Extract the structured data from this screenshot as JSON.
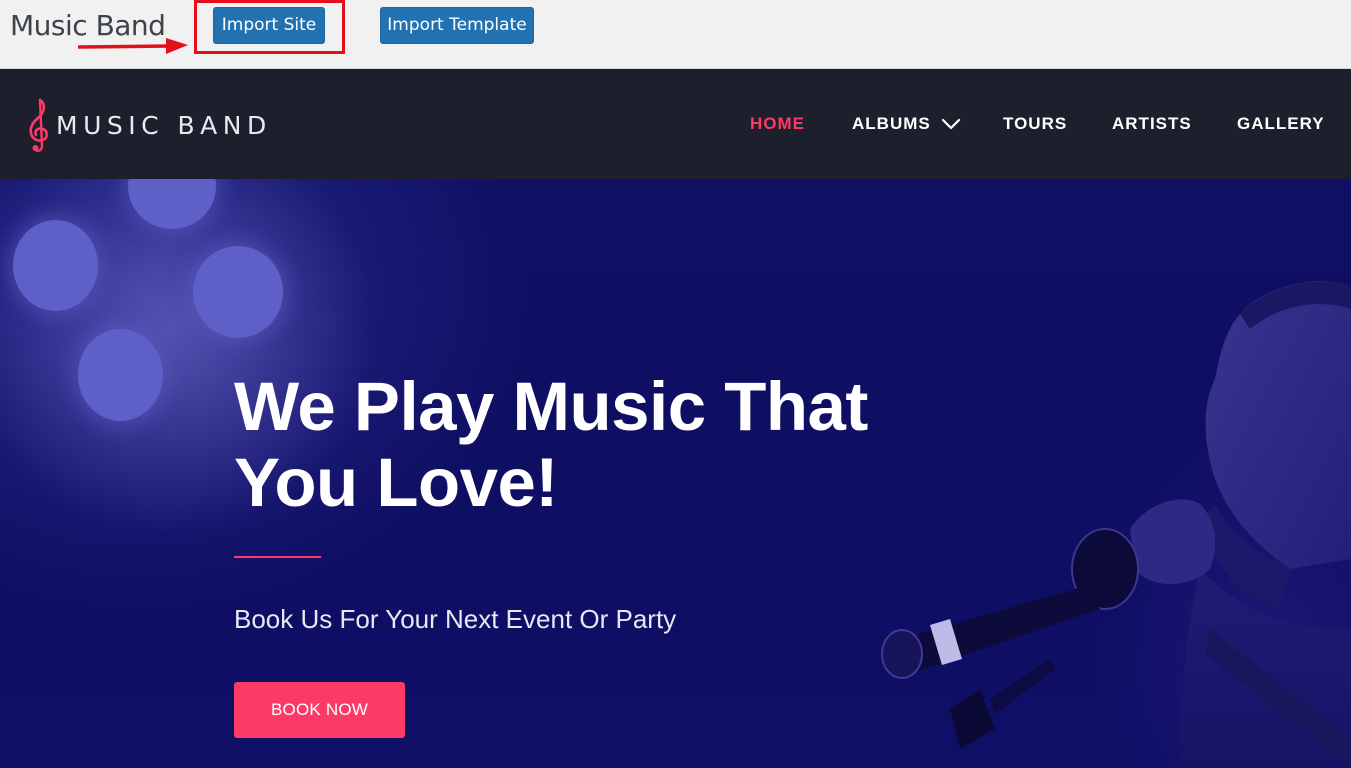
{
  "admin": {
    "site_title": "Music Band",
    "import_site_label": "Import Site",
    "import_template_label": "Import Template"
  },
  "header": {
    "logo_text": "MUSIC BAND",
    "nav": [
      {
        "label": "HOME",
        "active": true
      },
      {
        "label": "ALBUMS",
        "has_dropdown": true
      },
      {
        "label": "TOURS"
      },
      {
        "label": "ARTISTS"
      },
      {
        "label": "GALLERY"
      }
    ]
  },
  "hero": {
    "title": "We Play Music That You Love!",
    "subtitle": "Book Us For Your Next Event Or Party",
    "cta_label": "BOOK NOW"
  },
  "colors": {
    "accent": "#fb3b66",
    "admin_button": "#2271b1",
    "header_bg": "#1d1f2c",
    "hero_bg": "#0e0e62",
    "annotation": "#e3101c"
  },
  "icons": {
    "logo": "treble-clef-icon",
    "dropdown": "chevron-down-icon",
    "annotation": "red-arrow-icon"
  }
}
